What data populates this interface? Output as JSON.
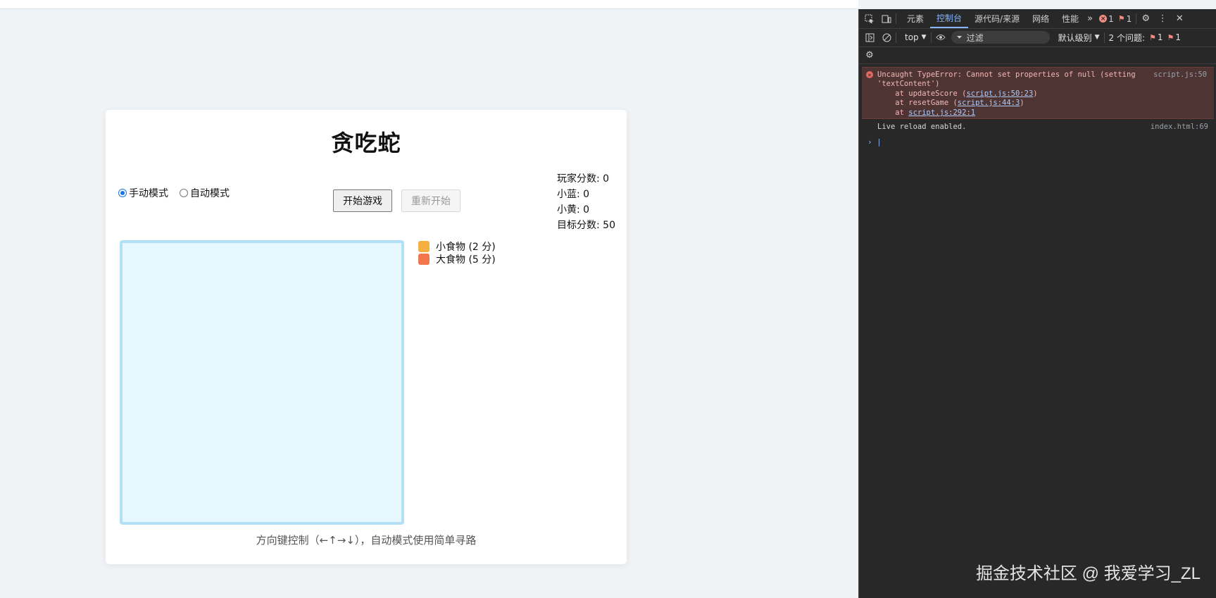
{
  "game": {
    "title": "贪吃蛇",
    "modes": [
      {
        "label": "手动模式",
        "selected": true
      },
      {
        "label": "自动模式",
        "selected": false
      }
    ],
    "start_button": "开始游戏",
    "restart_button": "重新开始",
    "scores": {
      "player": "玩家分数: 0",
      "blue": "小蓝: 0",
      "yellow": "小黄: 0",
      "target": "目标分数: 50"
    },
    "legend": [
      {
        "label": "小食物 (2 分)",
        "color": "#f5b041"
      },
      {
        "label": "大食物 (5 分)",
        "color": "#f2784b"
      }
    ],
    "hint": "方向键控制（←↑→↓），自动模式使用简单寻路"
  },
  "devtools": {
    "tabs": [
      "元素",
      "控制台",
      "源代码/来源",
      "网络",
      "性能"
    ],
    "active_tab": "控制台",
    "error_count": "1",
    "issue_count": "1",
    "context": "top",
    "filter_placeholder": "过滤",
    "level": "默认级别",
    "issues_label": "2 个问题:",
    "issues_error": "1",
    "issues_warn": "1",
    "error": {
      "line1": "Uncaught TypeError: Cannot set properties of null (setting",
      "line2": "'textContent')",
      "frame1_prefix": "    at updateScore (",
      "frame1_link": "script.js:50:23",
      "frame2_prefix": "    at resetGame (",
      "frame2_link": "script.js:44:3",
      "frame3_prefix": "    at ",
      "frame3_link": "script.js:292:1",
      "source": "script.js:50"
    },
    "log": {
      "text": "Live reload enabled.",
      "source": "index.html:69"
    }
  },
  "watermark": "掘金技术社区 @ 我爱学习_ZL"
}
